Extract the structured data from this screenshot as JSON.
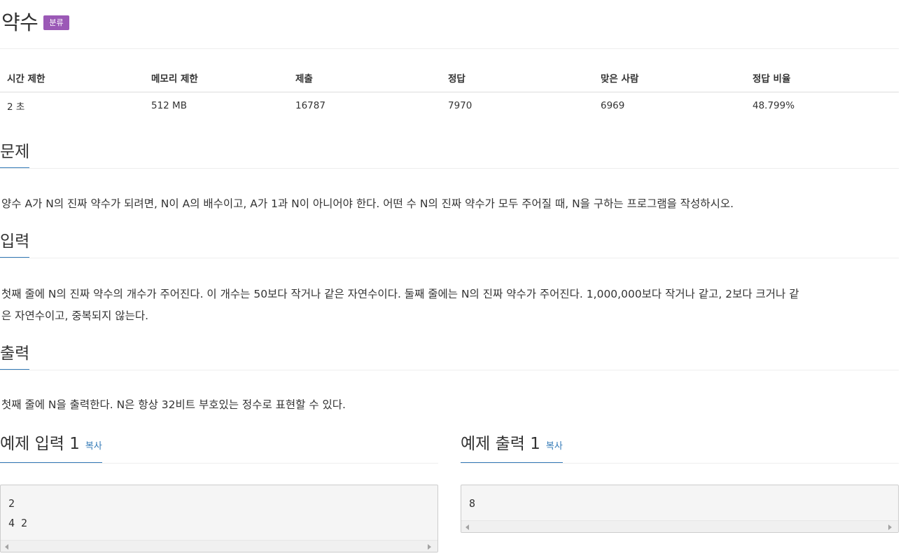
{
  "problem": {
    "title": "약수",
    "tag_badge": "분류"
  },
  "info_table": {
    "headers": [
      "시간 제한",
      "메모리 제한",
      "제출",
      "정답",
      "맞은 사람",
      "정답 비율"
    ],
    "values": [
      "2 초",
      "512 MB",
      "16787",
      "7970",
      "6969",
      "48.799%"
    ]
  },
  "sections": {
    "description": {
      "heading": "문제",
      "text": "양수 A가 N의 진짜 약수가 되려면, N이 A의 배수이고, A가 1과 N이 아니어야 한다. 어떤 수 N의 진짜 약수가 모두 주어질 때, N을 구하는 프로그램을 작성하시오."
    },
    "input": {
      "heading": "입력",
      "line1": "첫째 줄에 N의 진짜 약수의 개수가 주어진다. 이 개수는 50보다 작거나 같은 자연수이다. 둘째 줄에는 N의 진짜 약수가 주어진다. 1,000,000보다 작거나 같고, 2보다 크거나 같",
      "line2": "은 자연수이고, 중복되지 않는다."
    },
    "output": {
      "heading": "출력",
      "text": "첫째 줄에 N을 출력한다. N은 항상 32비트 부호있는 정수로 표현할 수 있다."
    }
  },
  "samples": {
    "input": {
      "heading": "예제 입력 1",
      "copy_label": "복사",
      "content": "2\n4 2"
    },
    "output": {
      "heading": "예제 출력 1",
      "copy_label": "복사",
      "content": "8"
    }
  },
  "colors": {
    "accent": "#337ab7",
    "badge": "#9b59b6"
  }
}
